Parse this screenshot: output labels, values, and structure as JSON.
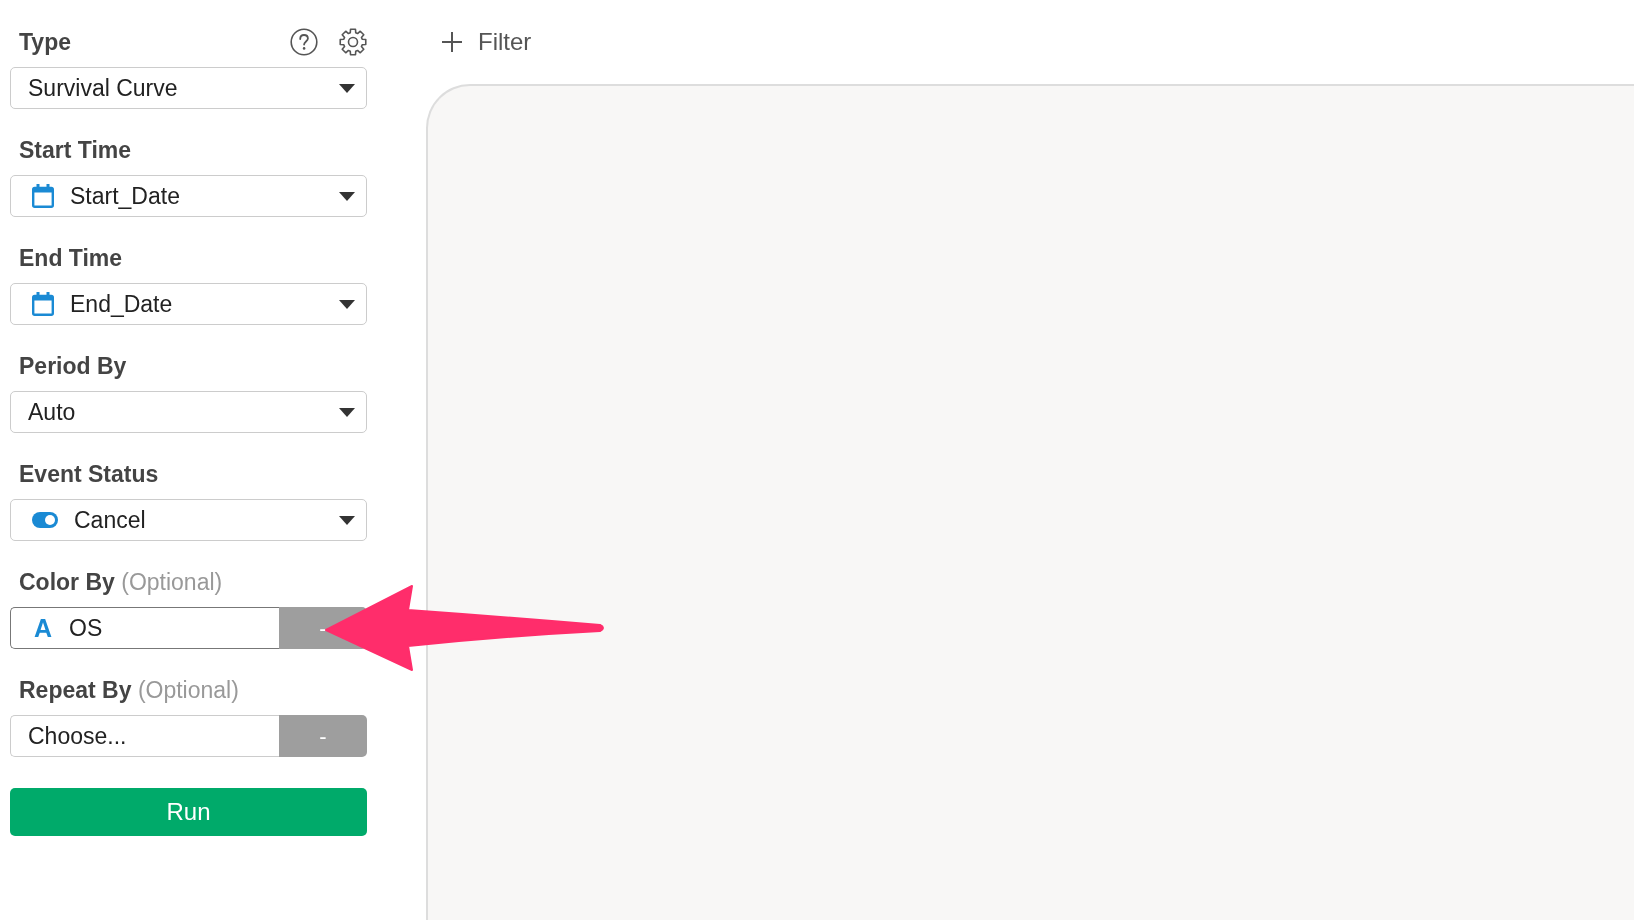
{
  "sidebar": {
    "fields": [
      {
        "label": "Type",
        "kind": "select",
        "value": "Survival Curve",
        "focused": false
      },
      {
        "label": "Start Time",
        "kind": "select",
        "icon": {
          "kind": "calendar"
        },
        "value": "Start_Date",
        "focused": false
      },
      {
        "label": "End Time",
        "kind": "select",
        "icon": {
          "kind": "calendar"
        },
        "value": "End_Date",
        "focused": false
      },
      {
        "label": "Period By",
        "kind": "select",
        "value": "Auto",
        "focused": false
      },
      {
        "label": "Event Status",
        "kind": "select",
        "icon": {
          "kind": "toggle"
        },
        "value": "Cancel",
        "focused": false
      },
      {
        "label": "Color By",
        "hint": "(Optional)",
        "kind": "clearable",
        "icon": {
          "kind": "glyph",
          "text": "A"
        },
        "value": "OS",
        "clear_label": "-",
        "focused": true
      },
      {
        "label": "Repeat By",
        "hint": "(Optional)",
        "kind": "clearable",
        "placeholder": "Choose...",
        "clear_label": "-",
        "focused": false
      }
    ],
    "run_button": "Run"
  },
  "toolbar": {
    "filter_button": "Filter"
  },
  "annotations": [
    {
      "kind": "arrow"
    }
  ]
}
